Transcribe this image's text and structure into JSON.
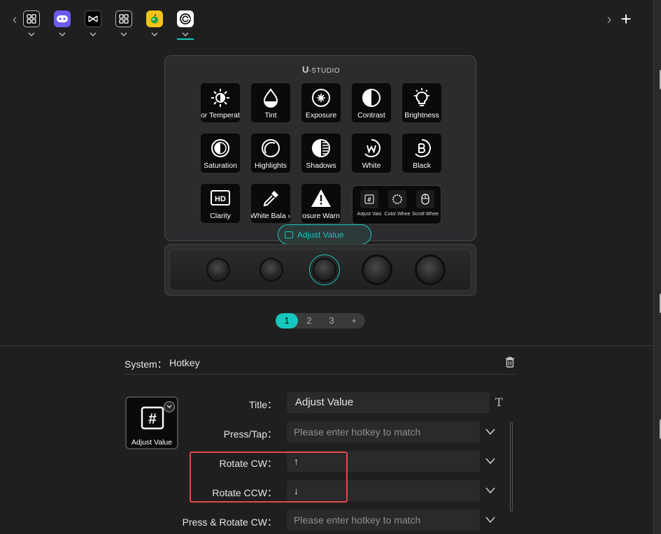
{
  "topbar": {
    "prev_arrow": "‹",
    "next_arrow": "›",
    "add_label": "+",
    "tabs": [
      {
        "name": "grid-app-1",
        "icon": "grid-icon"
      },
      {
        "name": "gamepad-app",
        "icon": "gamepad-icon"
      },
      {
        "name": "capcut-app",
        "icon": "capcut-icon"
      },
      {
        "name": "grid-app-2",
        "icon": "grid-icon"
      },
      {
        "name": "fruit-app",
        "icon": "fruit-icon"
      },
      {
        "name": "davinci-app",
        "icon": "circle-logo-icon",
        "active": true
      }
    ]
  },
  "device": {
    "brand_prefix": "U",
    "brand_suffix": "-STUDIO",
    "keys": [
      {
        "label": "Color Temperature",
        "shown": "or Temperat",
        "icon": "sun-half-icon"
      },
      {
        "label": "Tint",
        "icon": "drop-icon"
      },
      {
        "label": "Exposure",
        "icon": "aperture-icon"
      },
      {
        "label": "Contrast",
        "icon": "contrast-icon"
      },
      {
        "label": "Brightness",
        "icon": "bulb-icon"
      },
      {
        "label": "Saturation",
        "icon": "saturation-icon"
      },
      {
        "label": "Highlights",
        "icon": "highlights-icon"
      },
      {
        "label": "Shadows",
        "icon": "shadows-icon"
      },
      {
        "label": "White",
        "icon": "white-w-icon"
      },
      {
        "label": "Black",
        "icon": "black-b-icon"
      },
      {
        "label": "Clarity",
        "icon": "hd-icon"
      },
      {
        "label": "Auto White Balance",
        "shown": "‹ White Bala",
        "icon": "eyedropper-icon"
      },
      {
        "label": "Exposure Warning",
        "shown": "osure Warn",
        "icon": "warning-icon"
      }
    ],
    "combo": [
      {
        "label": "Adjust Value",
        "shown": "Adjust Valu",
        "icon": "hash-icon"
      },
      {
        "label": "Color Wheel",
        "shown": "Color Whee",
        "icon": "color-wheel-icon"
      },
      {
        "label": "Scroll Wheel",
        "shown": "Scroll Whee",
        "icon": "mouse-icon"
      }
    ],
    "selected_chip": "Adjust Value",
    "knobs": 5,
    "active_knob_index": 2
  },
  "pager": {
    "pages": [
      "1",
      "2",
      "3",
      "+"
    ],
    "active": "1"
  },
  "panel": {
    "system_label": "System：",
    "system_value": "Hotkey",
    "preview_label": "Adjust Value",
    "title_label": "Title：",
    "title_value": "Adjust Value",
    "press_tap_label": "Press/Tap：",
    "press_tap_placeholder": "Please enter hotkey to match",
    "rotate_cw_label": "Rotate CW：",
    "rotate_cw_value": "↑",
    "rotate_ccw_label": "Rotate CCW：",
    "rotate_ccw_value": "↓",
    "press_rotate_cw_label": "Press & Rotate CW：",
    "press_rotate_cw_placeholder": "Please enter hotkey to match",
    "text_tool_icon": "T"
  },
  "colors": {
    "accent": "#17c7be",
    "highlight": "#e0494a",
    "background": "#1f1f1f",
    "field": "#2a2a2a"
  }
}
